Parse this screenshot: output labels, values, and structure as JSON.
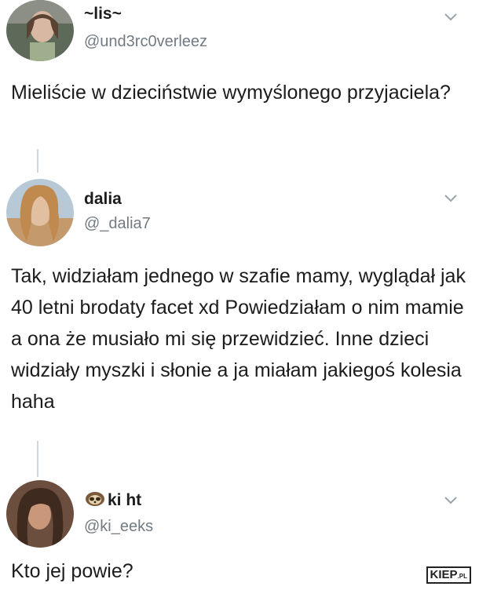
{
  "tweets": [
    {
      "name": "~lis~",
      "handle": "@und3rc0verleez",
      "text": "Mieliście w dzieciństwie wymyślonego przyjaciela?",
      "menu_icon": "chevron-down-icon"
    },
    {
      "name": "dalia",
      "handle": "@_dalia7",
      "text": "Tak, widziałam jednego w szafie mamy, wyglądał jak 40 letni brodaty facet xd Powiedziałam o nim mamie a ona że musiało mi się przewidzieć. Inne dzieci widziały myszki i słonie a ja miałam jakiegoś kolesia haha",
      "menu_icon": "chevron-down-icon"
    },
    {
      "name": "ki ht",
      "name_prefix_icon": "sloth-emoji-icon",
      "handle": "@ki_eeks",
      "text": "Kto jej powie?",
      "menu_icon": "chevron-down-icon"
    }
  ],
  "watermark": {
    "main": "KIEP",
    "suffix": ".PL"
  },
  "colors": {
    "text": "#1c1c1c",
    "handle": "#727a82",
    "thread_line": "#cfd6dc",
    "chevron": "#9aa3ab"
  }
}
